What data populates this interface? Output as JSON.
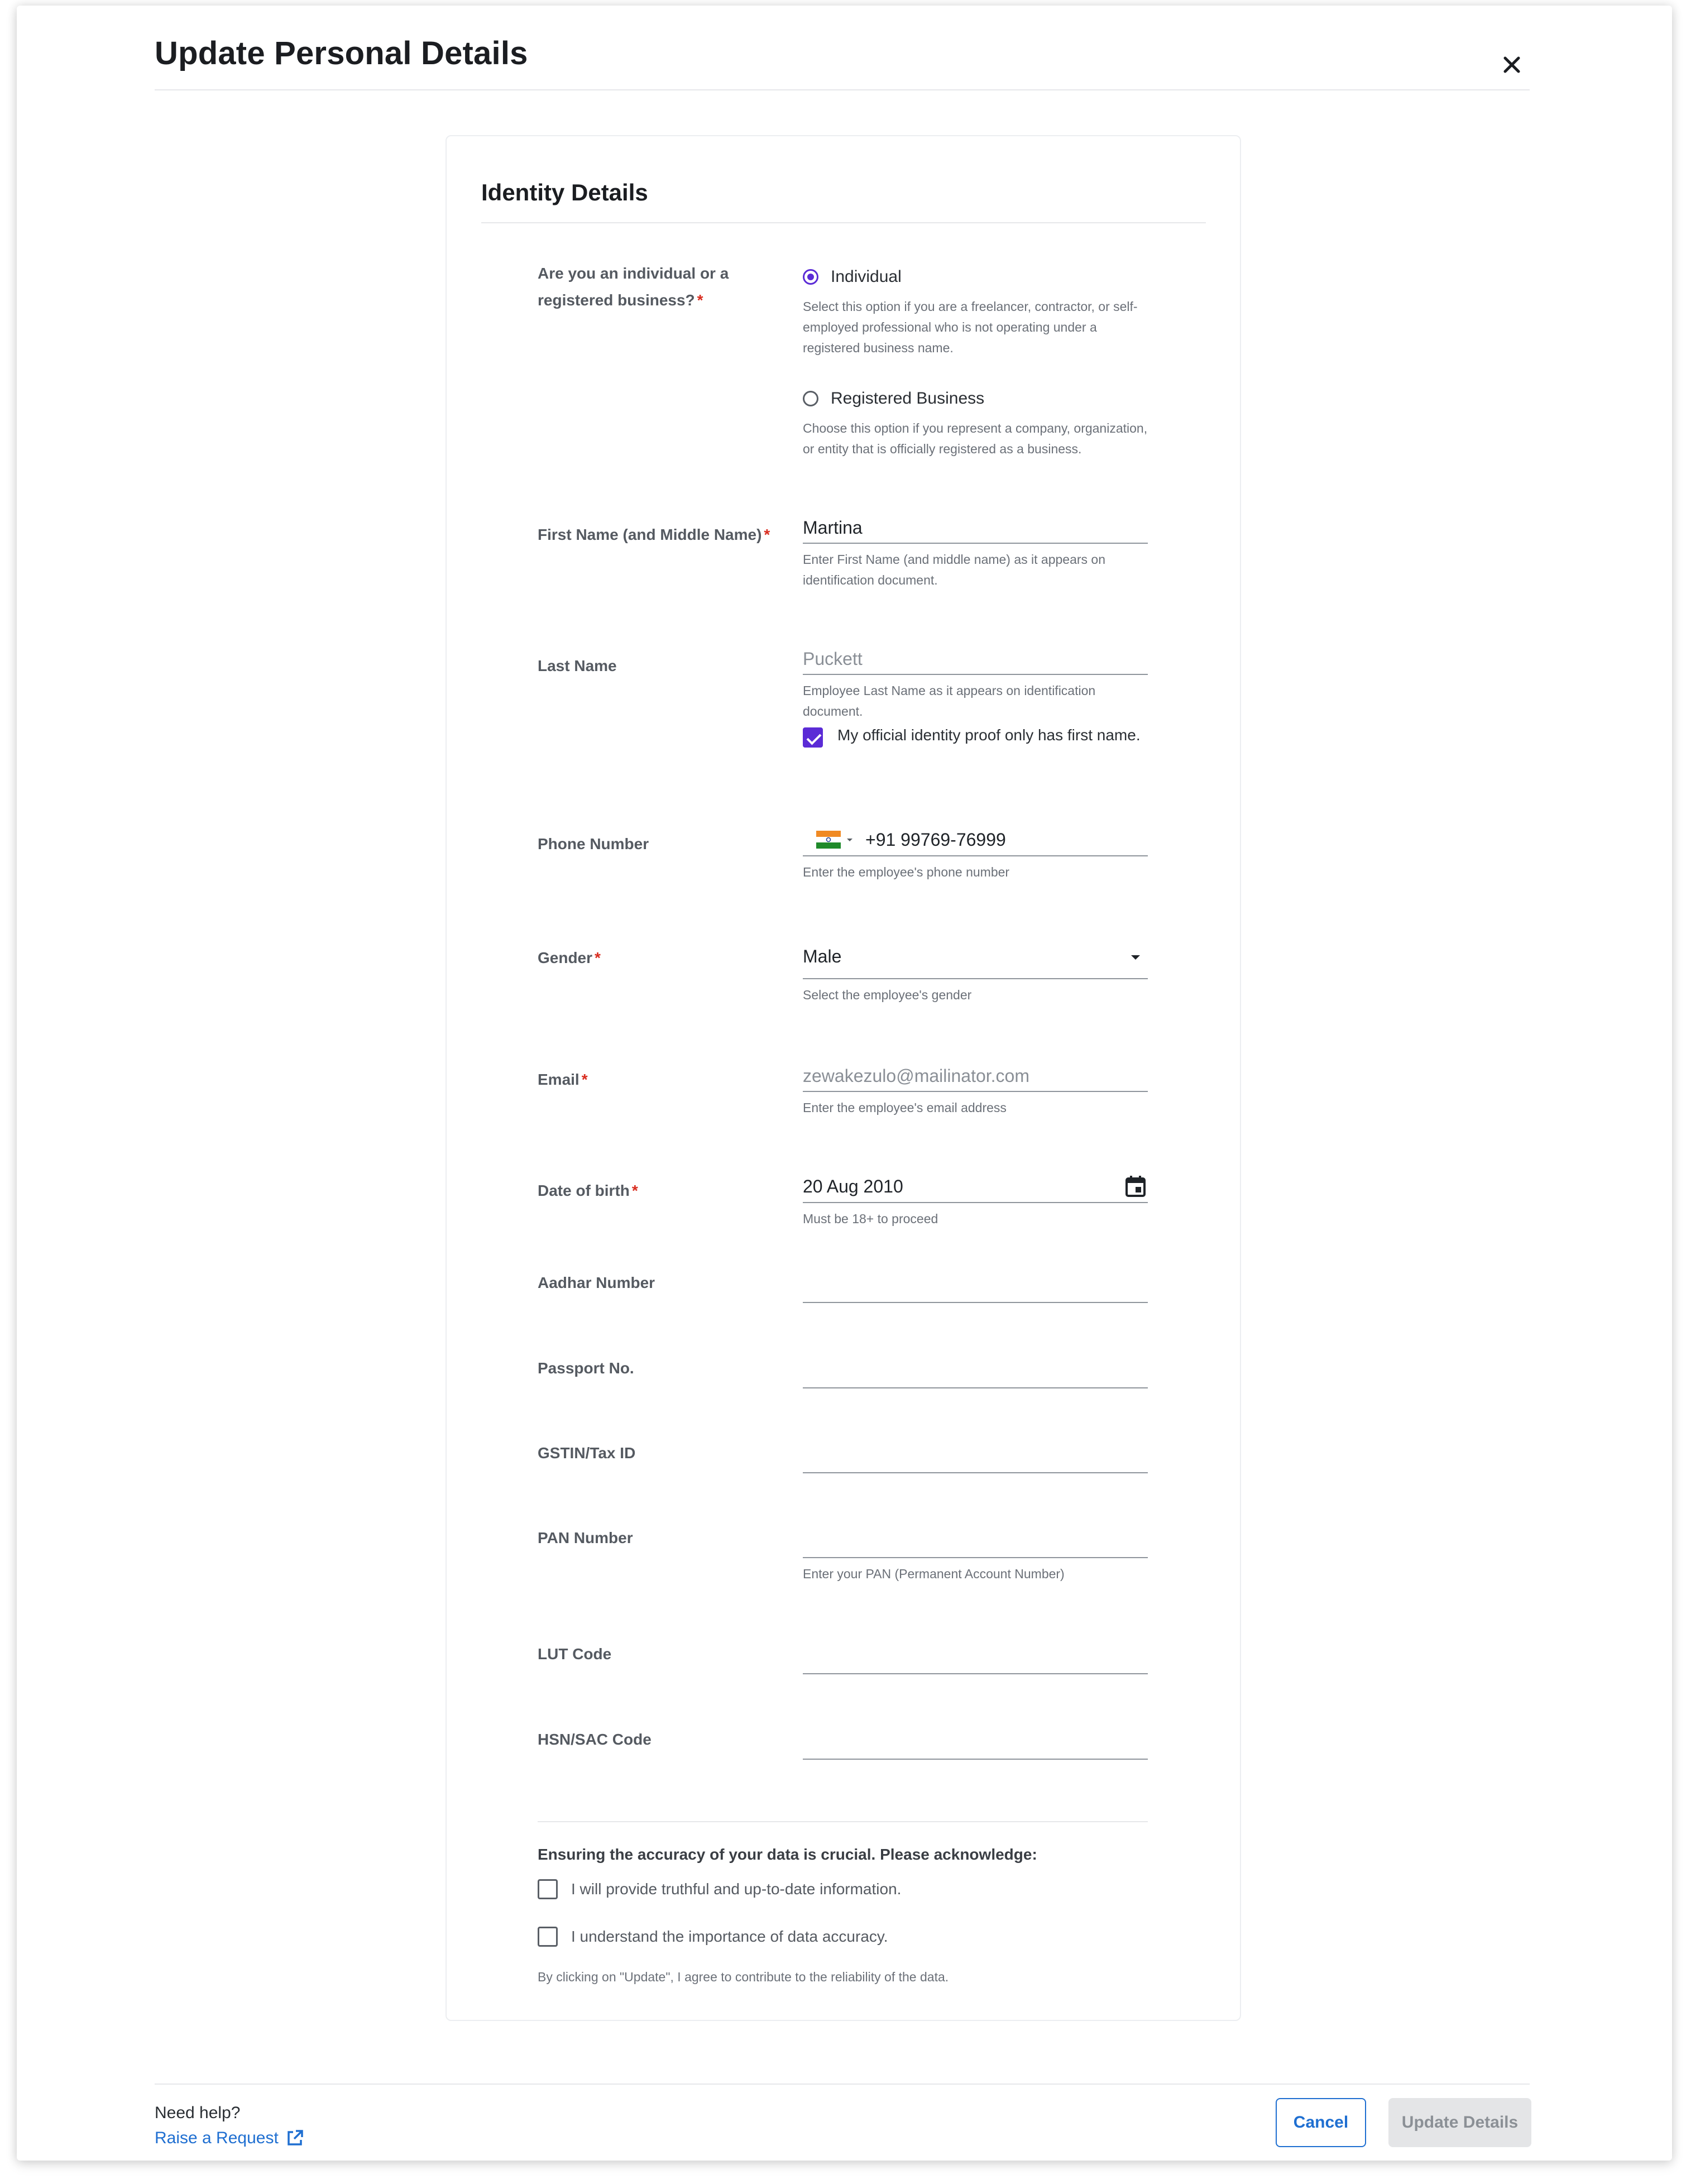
{
  "modal": {
    "title": "Update Personal Details",
    "close_icon": "close-icon"
  },
  "card": {
    "title": "Identity Details"
  },
  "entity_type": {
    "label": "Are you an individual or a registered business?",
    "required": "*",
    "options": [
      {
        "label": "Individual",
        "selected": true,
        "description": "Select this option if you are a freelancer, contractor, or self-employed professional who is not operating under a registered business name."
      },
      {
        "label": "Registered Business",
        "selected": false,
        "description": "Choose this option if you represent a company, organization, or entity that is officially registered as a business."
      }
    ]
  },
  "first_name": {
    "label": "First Name (and Middle Name)",
    "required": "*",
    "value": "Martina",
    "help": "Enter First Name (and middle name) as it appears on identification document."
  },
  "last_name": {
    "label": "Last Name",
    "value": "Puckett",
    "help": "Employee Last Name as it appears on identification document.",
    "only_first_name_label": "My official identity proof only has first name.",
    "only_first_name_checked": true
  },
  "phone": {
    "label": "Phone Number",
    "country_icon": "india-flag-icon",
    "value": "+91 99769-76999",
    "help": "Enter the employee's phone number"
  },
  "gender": {
    "label": "Gender",
    "required": "*",
    "value": "Male",
    "help": "Select the employee's gender"
  },
  "email": {
    "label": "Email",
    "required": "*",
    "value": "zewakezulo@mailinator.com",
    "help": "Enter the employee's email address"
  },
  "dob": {
    "label": "Date of birth",
    "required": "*",
    "value": "20 Aug 2010",
    "help": "Must be 18+ to proceed"
  },
  "aadhar": {
    "label": "Aadhar Number",
    "value": ""
  },
  "passport": {
    "label": "Passport No.",
    "value": ""
  },
  "gstin": {
    "label": "GSTIN/Tax ID",
    "value": ""
  },
  "pan": {
    "label": "PAN Number",
    "value": "",
    "help": "Enter your PAN (Permanent Account Number)"
  },
  "lut": {
    "label": "LUT Code",
    "value": ""
  },
  "hsn": {
    "label": "HSN/SAC Code",
    "value": ""
  },
  "acknowledge": {
    "heading": "Ensuring the accuracy of your data is crucial. Please acknowledge:",
    "items": [
      {
        "label": "I will provide truthful and up-to-date information.",
        "checked": false
      },
      {
        "label": "I understand the importance of data accuracy.",
        "checked": false
      }
    ],
    "note": "By clicking on \"Update\", I agree to contribute to the reliability of the data."
  },
  "footer": {
    "need_help": "Need help?",
    "raise_request": "Raise a Request",
    "cancel": "Cancel",
    "update": "Update Details"
  },
  "colors": {
    "accent": "#5b2bd6",
    "link": "#1f6fd1",
    "required": "#d92d20"
  }
}
